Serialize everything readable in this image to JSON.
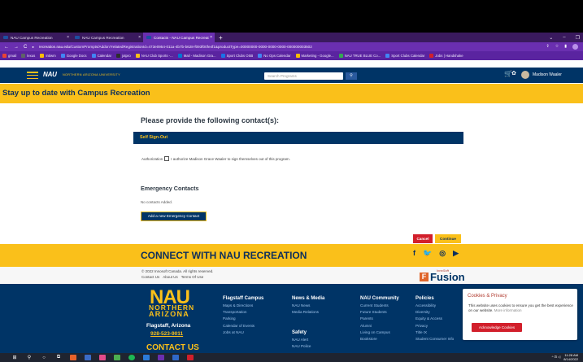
{
  "browser": {
    "tabs": [
      {
        "label": "NAU Campus Recreation",
        "active": false
      },
      {
        "label": "NAU Campus Recreation",
        "active": false
      },
      {
        "label": "Contacts - NAU Campus Recreat",
        "active": true
      }
    ],
    "new_tab": "+",
    "url_host": "recreation.nau.edu",
    "url_path": "/CustomPrompts/Addon?relatedRegistrationId=473e0954-011a-4b7b-b628-f093f00fe4f1&productType=00000000-0000-0000-0000-000000003502",
    "bookmarks": [
      {
        "label": "gmail",
        "color": "#ea4335"
      },
      {
        "label": "lexus",
        "color": "#5f6368"
      },
      {
        "label": "Intiwm",
        "color": "#fbbc04"
      },
      {
        "label": "Google Docs",
        "color": "#4285f4"
      },
      {
        "label": "Calendar",
        "color": "#4285f4"
      },
      {
        "label": "jotpro",
        "color": "#2d2d2d"
      },
      {
        "label": "NAU Club Sports -...",
        "color": "#fac01a"
      },
      {
        "label": "Mail - Madison Gra...",
        "color": "#0078d4"
      },
      {
        "label": "Sport Clubs OSB",
        "color": "#1a73e8"
      },
      {
        "label": "No Ops Calendar",
        "color": "#4285f4"
      },
      {
        "label": "Marketing - Google...",
        "color": "#fbbc04"
      },
      {
        "label": "NAU TRUE BLUE Co...",
        "color": "#34a853"
      },
      {
        "label": "Sport Clubs Calendar",
        "color": "#4285f4"
      },
      {
        "label": "Jobs | Handshake",
        "color": "#d21f2b"
      }
    ]
  },
  "header": {
    "logo": "NAU",
    "logo_sub": "NORTHERN ARIZONA UNIVERSITY",
    "search_placeholder": "Search Programs",
    "user_name": "Madison Waaler"
  },
  "banner": {
    "title": "Stay up to date with Campus Recreation"
  },
  "main": {
    "title": "Please provide the following contact(s):",
    "signout_title": "Self Sign-Out",
    "auth_prefix": "Authorization",
    "auth_text": "I authorize Madison Grace Waaler to sign themselves out of this program.",
    "emergency_title": "Emergency Contacts",
    "no_contacts": "No contacts Added.",
    "add_button": "Add a new Emergency Contact",
    "cancel": "Cancel",
    "continue": "Continue"
  },
  "footer": {
    "connect": "CONNECT WITH NAU RECREATION",
    "social_icons": [
      "facebook-icon",
      "twitter-icon",
      "instagram-icon",
      "youtube-icon"
    ],
    "copyright": "© 2022 Innosoft Canada. All rights reserved.",
    "links": [
      "Contact Us",
      "About Us",
      "Terms Of Use"
    ],
    "fusion_small": "InnoSoft",
    "fusion": "Fusion",
    "brand_big": "NAU",
    "brand_northern": "NORTHERN",
    "brand_arizona": "ARIZONA",
    "city": "Flagstaff, Arizona",
    "phone": "928-523-9011",
    "contact_us": "CONTACT US",
    "columns": [
      {
        "heading": "Flagstaff Campus",
        "links": [
          "Maps & Directions",
          "Transportation",
          "Parking",
          "Calendar of Events",
          "Jobs at NAU"
        ]
      },
      {
        "heading": "News & Media",
        "links": [
          "NAU News",
          "Media Relations"
        ]
      },
      {
        "heading": "Safety",
        "links": [
          "NAU Alert",
          "NAU Police"
        ]
      },
      {
        "heading": "NAU Community",
        "links": [
          "Current Students",
          "Future Students",
          "Parents",
          "Alumni",
          "Living on Campus",
          "Bookstore"
        ]
      },
      {
        "heading": "Policies",
        "links": [
          "Accessibility",
          "Diversity",
          "Equity & Access",
          "Privacy",
          "Title IX",
          "Student Consumer Info"
        ]
      }
    ]
  },
  "cookie": {
    "title": "Cookies & Privacy",
    "text": "This website uses cookies to ensure you get the best experience on our website.",
    "more": "More information",
    "button": "Acknowledge Cookies"
  },
  "taskbar": {
    "time": "11:28 AM",
    "date": "8/14/2022"
  }
}
